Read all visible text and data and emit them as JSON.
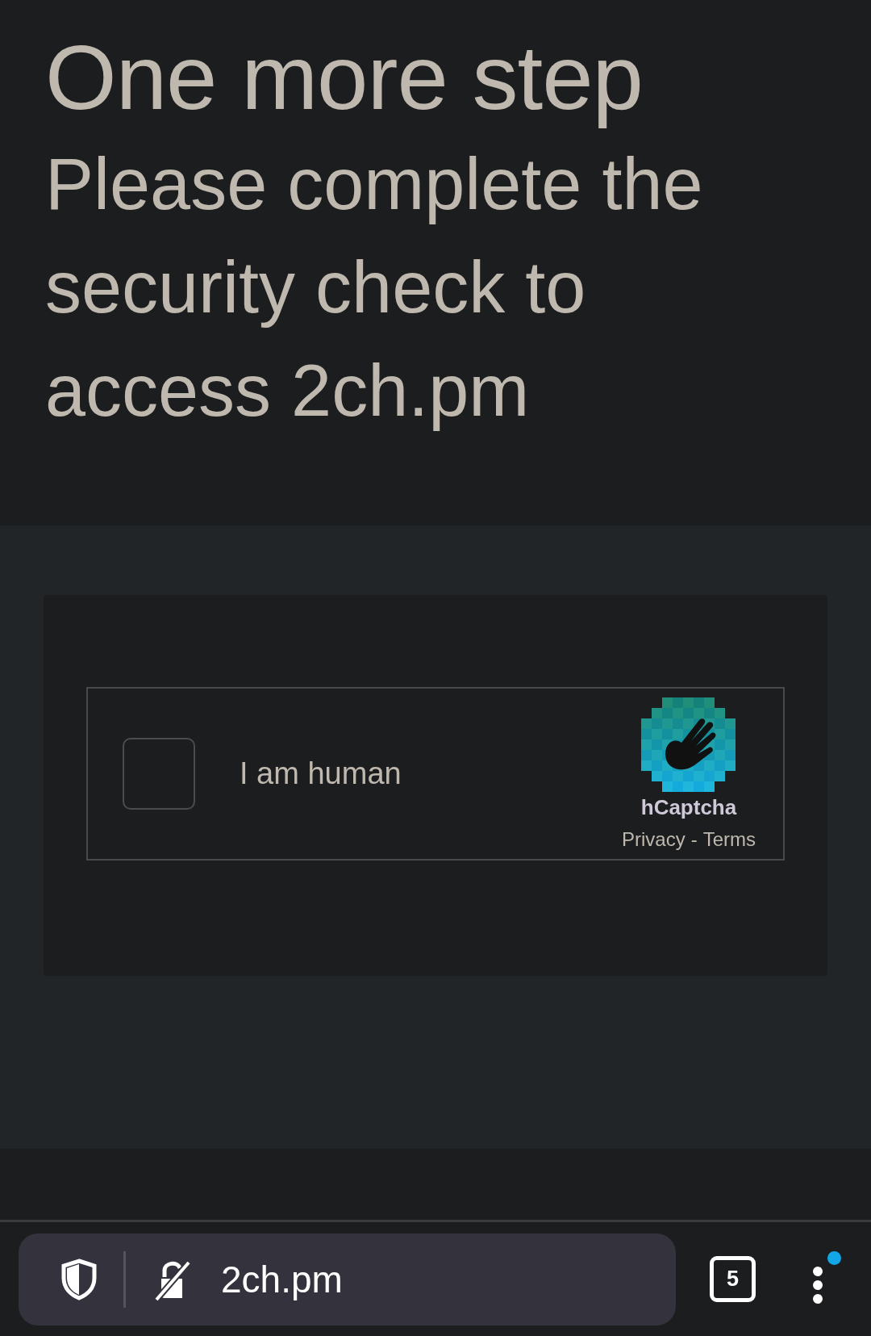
{
  "heading": "One more step",
  "subheading": "Please complete the security check to access 2ch.pm",
  "captcha": {
    "checked": false,
    "label": "I am human",
    "brand": "hCaptcha",
    "links": [
      {
        "text": "Privacy"
      },
      {
        "text": "Terms"
      }
    ],
    "separator": "-"
  },
  "browser_bar": {
    "url": "2ch.pm",
    "tab_count": "5",
    "menu_notification": true
  }
}
